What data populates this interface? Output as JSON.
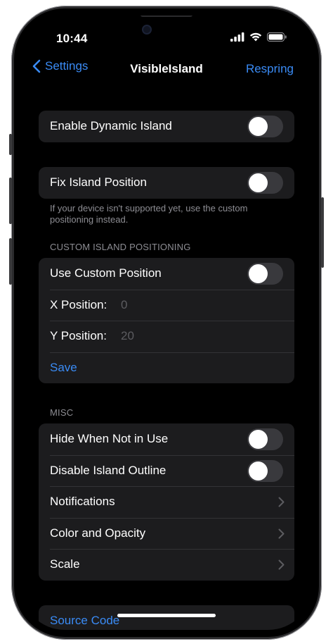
{
  "status_bar": {
    "time": "10:44",
    "icons": [
      "cellular-signal-icon",
      "wifi-icon",
      "battery-icon"
    ]
  },
  "nav": {
    "back_label": "Settings",
    "title": "VisibleIsland",
    "action_label": "Respring"
  },
  "group_main": {
    "enable_label": "Enable Dynamic Island",
    "enable_on": false
  },
  "group_fix": {
    "fix_label": "Fix Island Position",
    "fix_on": false,
    "footer": "If your device isn't supported yet, use the custom positioning instead."
  },
  "custom": {
    "header": "CUSTOM ISLAND POSITIONING",
    "use_custom_label": "Use Custom Position",
    "use_custom_on": false,
    "x_label": "X Position:",
    "x_placeholder": "0",
    "y_label": "Y Position:",
    "y_placeholder": "20",
    "save_label": "Save"
  },
  "misc": {
    "header": "MISC",
    "hide_label": "Hide When Not in Use",
    "hide_on": false,
    "outline_label": "Disable Island Outline",
    "outline_on": false,
    "notifications_label": "Notifications",
    "color_label": "Color and Opacity",
    "scale_label": "Scale"
  },
  "links": {
    "source_code_label": "Source Code"
  },
  "colors": {
    "accent": "#3a8bf5",
    "background": "#000000",
    "cell": "#1c1c1e",
    "secondary_text": "#8d8d93"
  }
}
